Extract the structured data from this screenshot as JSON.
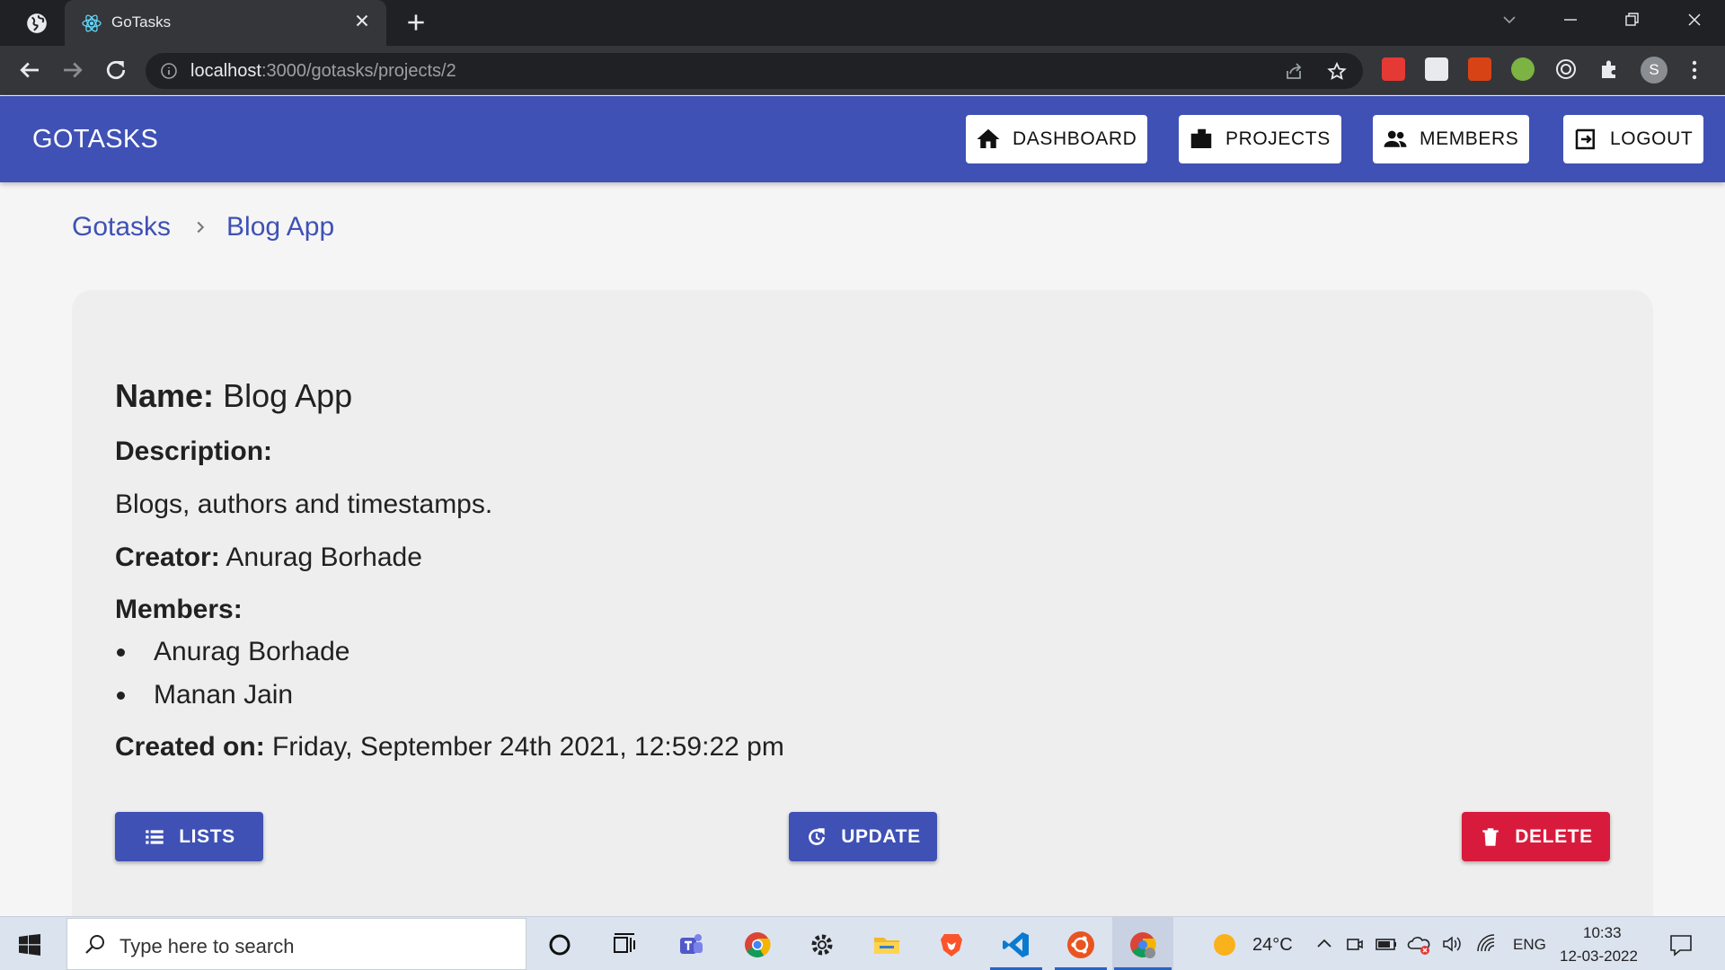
{
  "browser": {
    "tab_title": "GoTasks",
    "url_host": "localhost",
    "url_path": ":3000/gotasks/projects/2",
    "profile_initial": "S"
  },
  "appbar": {
    "brand": "GOTASKS",
    "nav": [
      {
        "label": "DASHBOARD",
        "icon": "home-icon"
      },
      {
        "label": "PROJECTS",
        "icon": "briefcase-icon"
      },
      {
        "label": "MEMBERS",
        "icon": "people-icon"
      },
      {
        "label": "LOGOUT",
        "icon": "logout-icon"
      }
    ]
  },
  "breadcrumb": {
    "root": "Gotasks",
    "current": "Blog App"
  },
  "project": {
    "name_label": "Name:",
    "name": "Blog App",
    "description_label": "Description:",
    "description": "Blogs, authors and timestamps.",
    "creator_label": "Creator:",
    "creator": "Anurag Borhade",
    "members_label": "Members:",
    "members": [
      "Anurag Borhade",
      "Manan Jain"
    ],
    "created_label": "Created on:",
    "created_on": "Friday, September 24th 2021, 12:59:22 pm"
  },
  "actions": {
    "lists_label": "LISTS",
    "update_label": "UPDATE",
    "delete_label": "DELETE"
  },
  "colors": {
    "primary": "#3f51b5",
    "danger": "#d81b3c"
  },
  "taskbar": {
    "search_placeholder": "Type here to search",
    "temperature": "24°C",
    "language": "ENG",
    "time": "10:33",
    "date": "12-03-2022"
  }
}
